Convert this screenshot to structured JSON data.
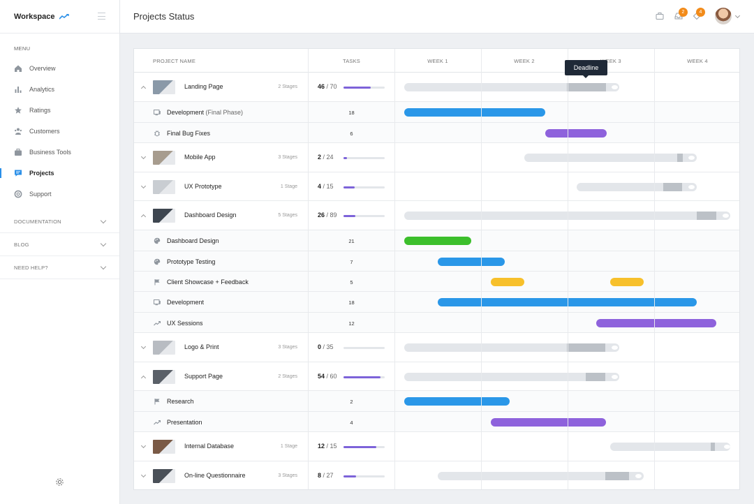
{
  "brand": {
    "name": "Workspace"
  },
  "header": {
    "title": "Projects Status",
    "notif_badge": "2",
    "messages_badge": "4"
  },
  "sidebar": {
    "menu_label": "MENU",
    "items": [
      {
        "label": "Overview",
        "icon": "home-icon"
      },
      {
        "label": "Analytics",
        "icon": "bar-chart-icon"
      },
      {
        "label": "Ratings",
        "icon": "star-icon"
      },
      {
        "label": "Customers",
        "icon": "users-icon"
      },
      {
        "label": "Business Tools",
        "icon": "briefcase-icon"
      },
      {
        "label": "Projects",
        "icon": "chat-icon",
        "active": true
      },
      {
        "label": "Support",
        "icon": "lifebuoy-icon"
      }
    ],
    "sections": [
      {
        "label": "DOCUMENTATION"
      },
      {
        "label": "BLOG"
      },
      {
        "label": "NEED HELP?"
      }
    ]
  },
  "table": {
    "headers": {
      "project": "PROJECT NAME",
      "tasks": "TASKS",
      "weeks": [
        "WEEK 1",
        "WEEK 2",
        "WEEK 3",
        "WEEK 4"
      ]
    },
    "tooltip": "Deadline",
    "colors": {
      "blue": "#2a97e8",
      "purple": "#8e62dc",
      "green": "#3cbf2c",
      "yellow": "#f7c02b",
      "progress": "#7d63d9"
    },
    "rows": [
      {
        "type": "project",
        "expanded": true,
        "name": "Landing Page",
        "stages": "2 Stages",
        "done": "46",
        "total": "/ 70",
        "progress": 0.66,
        "thumb": "#8a99a8"
      },
      {
        "type": "task",
        "name": "Development",
        "name_suffix": " (Final Phase)",
        "icon": "monitor-icon",
        "count": "18",
        "color": "blue"
      },
      {
        "type": "task",
        "name": "Final Bug Fixes",
        "icon": "bug-icon",
        "count": "6",
        "color": "purple"
      },
      {
        "type": "project",
        "expanded": false,
        "name": "Mobile App",
        "stages": "3 Stages",
        "done": "2",
        "total": "/ 24",
        "progress": 0.08,
        "thumb": "#a79c8e"
      },
      {
        "type": "project",
        "expanded": false,
        "name": "UX Prototype",
        "stages": "1 Stage",
        "done": "4",
        "total": "/ 15",
        "progress": 0.27,
        "thumb": "#c9cdd2"
      },
      {
        "type": "project",
        "expanded": true,
        "name": "Dashboard Design",
        "stages": "5 Stages",
        "done": "26",
        "total": "/ 89",
        "progress": 0.29,
        "thumb": "#3e4650"
      },
      {
        "type": "task",
        "name": "Dashboard Design",
        "icon": "palette-icon",
        "count": "21",
        "color": "green"
      },
      {
        "type": "task",
        "name": "Prototype Testing",
        "icon": "palette-icon",
        "count": "7",
        "color": "blue"
      },
      {
        "type": "task",
        "name": "Client Showcase + Feedback",
        "icon": "flag-icon",
        "count": "5",
        "color": "yellow"
      },
      {
        "type": "task",
        "name": "Development",
        "icon": "monitor-icon",
        "count": "18",
        "color": "blue"
      },
      {
        "type": "task",
        "name": "UX Sessions",
        "icon": "trend-icon",
        "count": "12",
        "color": "purple"
      },
      {
        "type": "project",
        "expanded": false,
        "name": "Logo & Print",
        "stages": "3 Stages",
        "done": "0",
        "total": "/ 35",
        "progress": 0.0,
        "thumb": "#b8bcc2"
      },
      {
        "type": "project",
        "expanded": true,
        "name": "Support Page",
        "stages": "2 Stages",
        "done": "54",
        "total": "/ 60",
        "progress": 0.9,
        "thumb": "#5a6068"
      },
      {
        "type": "task",
        "name": "Research",
        "icon": "flag-icon",
        "count": "2",
        "color": "blue"
      },
      {
        "type": "task",
        "name": "Presentation",
        "icon": "trend-icon",
        "count": "4",
        "color": "purple"
      },
      {
        "type": "project",
        "expanded": false,
        "name": "Internal Database",
        "stages": "1 Stage",
        "done": "12",
        "total": "/ 15",
        "progress": 0.8,
        "thumb": "#7a5a46"
      },
      {
        "type": "project",
        "expanded": false,
        "name": "On-line Questionnaire",
        "stages": "3 Stages",
        "done": "8",
        "total": "/ 27",
        "progress": 0.3,
        "thumb": "#4a5058"
      }
    ]
  }
}
